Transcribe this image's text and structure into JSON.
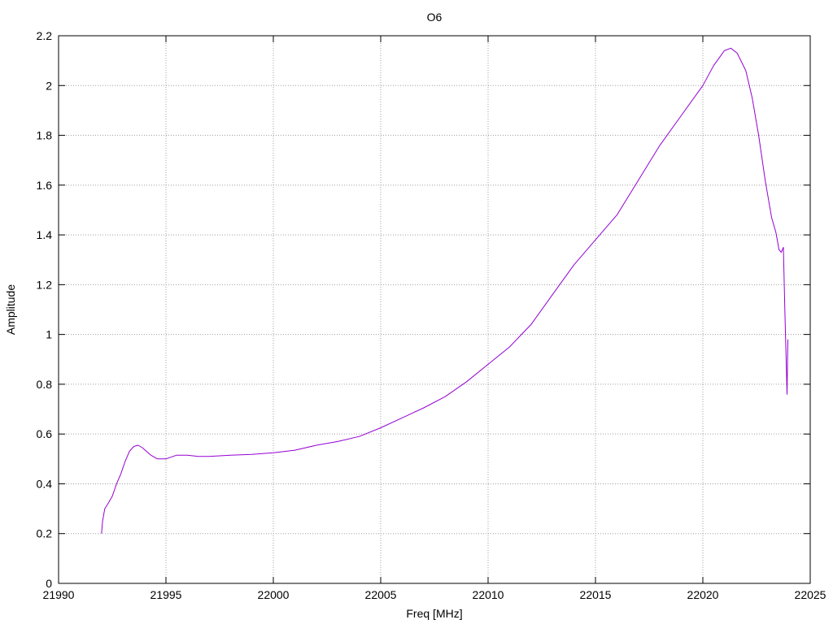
{
  "chart_data": {
    "type": "line",
    "title": "O6",
    "xlabel": "Freq [MHz]",
    "ylabel": "Amplitude",
    "xlim": [
      21990,
      22025
    ],
    "ylim": [
      0,
      2.2
    ],
    "x_ticks": [
      21990,
      21995,
      22000,
      22005,
      22010,
      22015,
      22020,
      22025
    ],
    "x_tick_labels": [
      "21990",
      "21995",
      "22000",
      "22005",
      "22010",
      "22015",
      "22020",
      "22025"
    ],
    "y_ticks": [
      0,
      0.2,
      0.4,
      0.6,
      0.8,
      1,
      1.2,
      1.4,
      1.6,
      1.8,
      2,
      2.2
    ],
    "y_tick_labels": [
      "0",
      "0.2",
      "0.4",
      "0.6",
      "0.8",
      "1",
      "1.2",
      "1.4",
      "1.6",
      "1.8",
      "2",
      "2.2"
    ],
    "grid": true,
    "legend": "none",
    "series": [
      {
        "color": "#9400d3",
        "x": [
          21992.0,
          21992.05,
          21992.15,
          21992.3,
          21992.5,
          21992.7,
          21992.9,
          21993.1,
          21993.3,
          21993.5,
          21993.7,
          21993.9,
          21994.1,
          21994.3,
          21994.6,
          21995.0,
          21995.5,
          21996.0,
          21996.5,
          21997.0,
          21998.0,
          21999.0,
          22000.0,
          22001.0,
          22002.0,
          22003.0,
          22004.0,
          22005.0,
          22006.0,
          22007.0,
          22008.0,
          22009.0,
          22010.0,
          22011.0,
          22012.0,
          22013.0,
          22014.0,
          22015.0,
          22016.0,
          22017.0,
          22018.0,
          22019.0,
          22020.0,
          22020.5,
          22021.0,
          22021.3,
          22021.6,
          22022.0,
          22022.3,
          22022.6,
          22022.9,
          22023.2,
          22023.4,
          22023.55,
          22023.65,
          22023.75,
          22023.82,
          22023.88,
          22023.92,
          22023.96
        ],
        "y": [
          0.2,
          0.25,
          0.3,
          0.32,
          0.35,
          0.4,
          0.44,
          0.49,
          0.53,
          0.55,
          0.555,
          0.545,
          0.53,
          0.515,
          0.5,
          0.5,
          0.515,
          0.515,
          0.51,
          0.51,
          0.515,
          0.518,
          0.525,
          0.535,
          0.555,
          0.57,
          0.59,
          0.625,
          0.665,
          0.705,
          0.75,
          0.81,
          0.88,
          0.95,
          1.04,
          1.16,
          1.28,
          1.38,
          1.48,
          1.62,
          1.76,
          1.88,
          2.0,
          2.08,
          2.14,
          2.15,
          2.13,
          2.06,
          1.95,
          1.8,
          1.62,
          1.47,
          1.41,
          1.34,
          1.33,
          1.35,
          1.1,
          0.9,
          0.76,
          0.98
        ]
      }
    ]
  }
}
